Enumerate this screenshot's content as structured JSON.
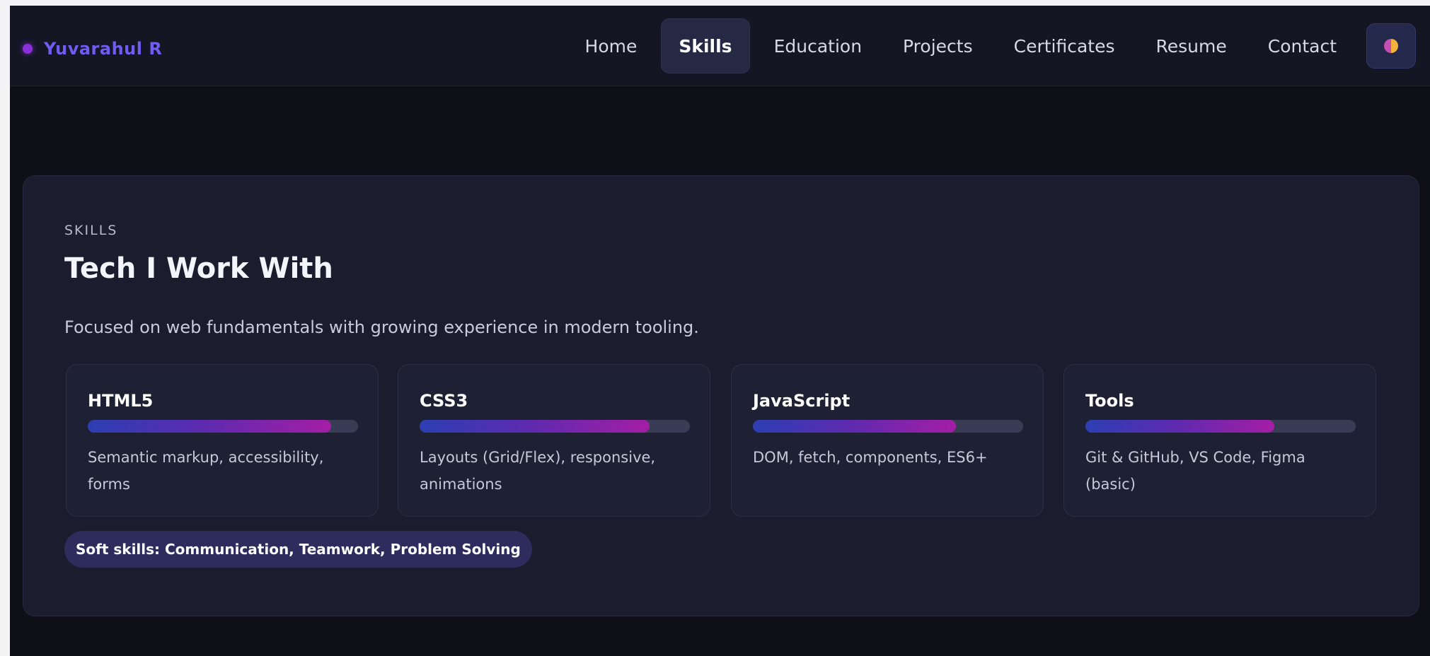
{
  "brand": {
    "name": "Yuvarahul R"
  },
  "nav": {
    "items": [
      {
        "label": "Home",
        "active": false
      },
      {
        "label": "Skills",
        "active": true
      },
      {
        "label": "Education",
        "active": false
      },
      {
        "label": "Projects",
        "active": false
      },
      {
        "label": "Certificates",
        "active": false
      },
      {
        "label": "Resume",
        "active": false
      },
      {
        "label": "Contact",
        "active": false
      }
    ],
    "theme_toggle_icon": "half-circle-theme-icon"
  },
  "section": {
    "eyebrow": "SKILLS",
    "heading": "Tech I Work With",
    "lede": "Focused on web fundamentals with growing experience in modern tooling.",
    "skills": [
      {
        "title": "HTML5",
        "level_percent": 90,
        "desc": "Semantic markup, accessibility, forms"
      },
      {
        "title": "CSS3",
        "level_percent": 85,
        "desc": "Layouts (Grid/Flex), responsive, animations"
      },
      {
        "title": "JavaScript",
        "level_percent": 75,
        "desc": "DOM, fetch, components, ES6+"
      },
      {
        "title": "Tools",
        "level_percent": 70,
        "desc": "Git & GitHub, VS Code, Figma (basic)"
      }
    ],
    "soft_skills": "Soft skills: Communication, Teamwork, Problem Solving"
  },
  "colors": {
    "background": "#0e0f17",
    "card": "#1b1d2f",
    "brand_accent": "#6f5cf0",
    "bar_gradient_start": "#2d3fb2",
    "bar_gradient_end": "#a41ea5"
  }
}
